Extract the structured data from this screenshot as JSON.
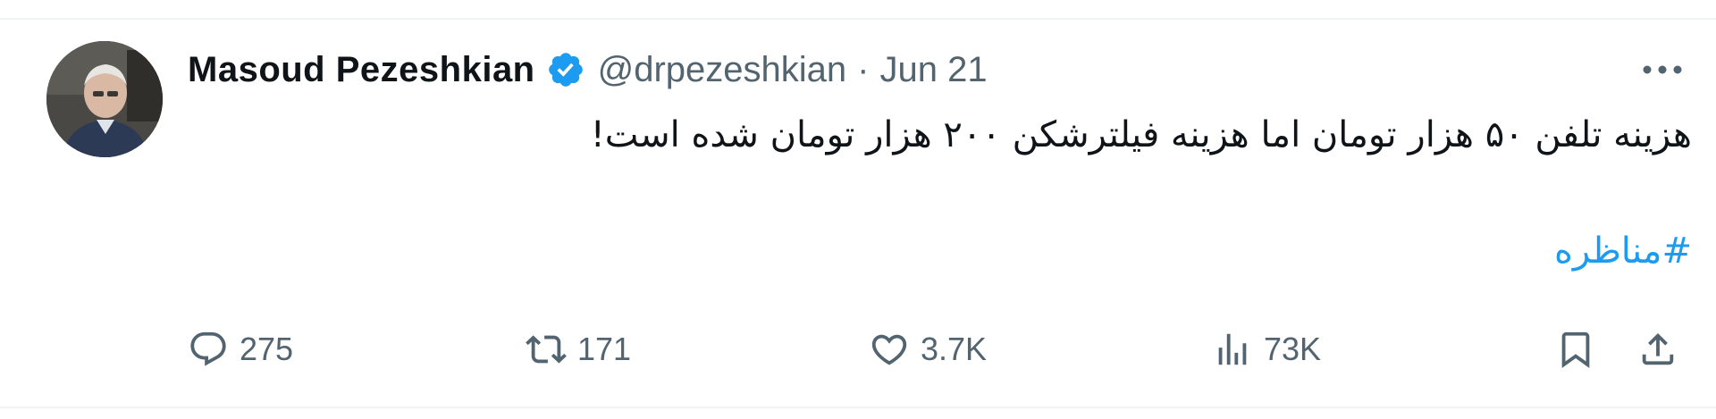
{
  "author": {
    "name": "Masoud Pezeshkian",
    "handle": "@drpezeshkian",
    "separator": "·",
    "date": "Jun 21"
  },
  "tweet": {
    "text": "هزینه تلفن ۵۰ هزار تومان اما هزینه فیلترشکن ۲۰۰ هزار تومان شده است!",
    "hashtag": "#مناظره"
  },
  "actions": {
    "replies": "275",
    "retweets": "171",
    "likes": "3.7K",
    "views": "73K"
  },
  "colors": {
    "text": "#0f1419",
    "secondary": "#536471",
    "accent": "#1d9bf0",
    "divider": "#eff3f4"
  },
  "icons": [
    "verified-badge-icon",
    "more-icon",
    "reply-icon",
    "retweet-icon",
    "like-icon",
    "views-icon",
    "bookmark-icon",
    "share-icon"
  ]
}
